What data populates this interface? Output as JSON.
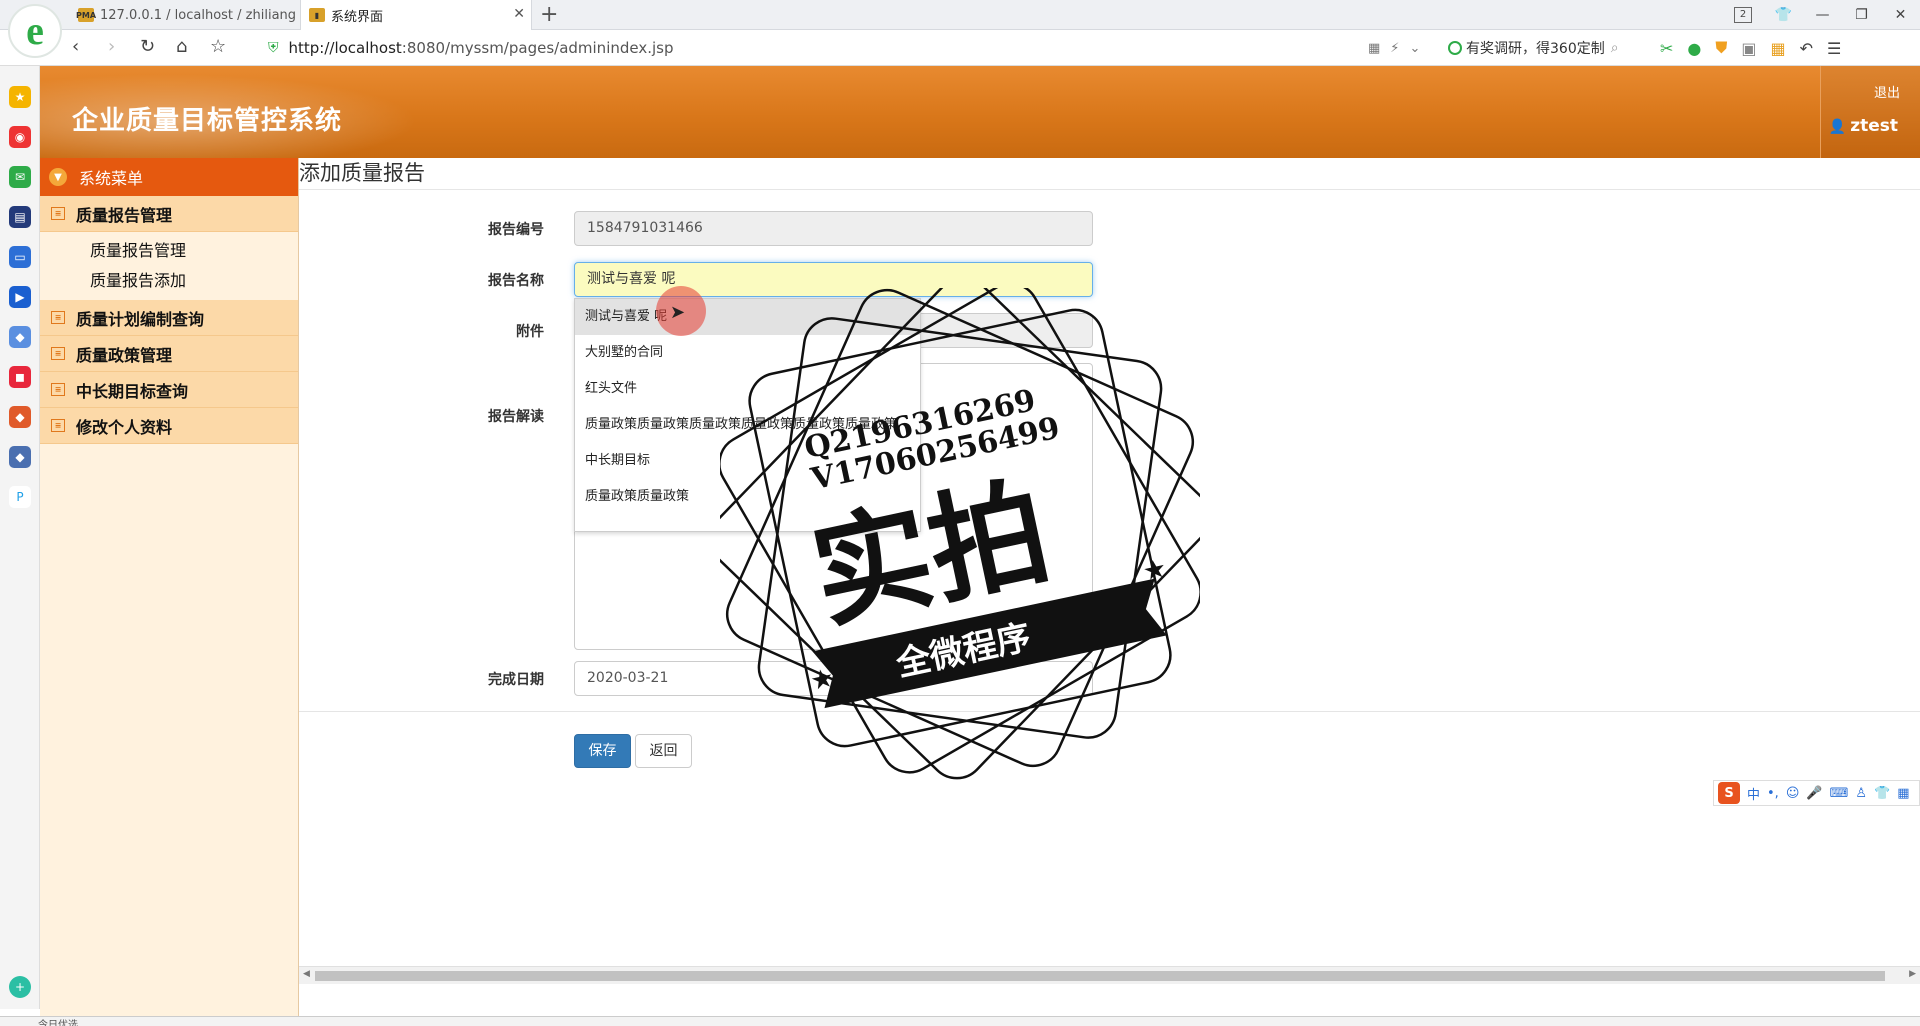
{
  "browser": {
    "tabs": [
      {
        "label": "127.0.0.1 / localhost / zhiliang"
      },
      {
        "label": "系统界面"
      }
    ],
    "tab_count": "2",
    "url_host": "http://localhost",
    "url_rest": ":8080/myssm/pages/adminindex.jsp",
    "promo_text": "有奖调研，得360定制",
    "status_text": "今日优选"
  },
  "app": {
    "title": "企业质量目标管控系统",
    "logout_label": "退出",
    "username": "ztest",
    "colors": {
      "header": "#d9771a",
      "menu_head": "#e5590f",
      "menu_group": "#fcd9a8",
      "primary_button": "#337ab7"
    }
  },
  "menu": {
    "header": "系统菜单",
    "groups": [
      {
        "label": "质量报告管理",
        "items": [
          "质量报告管理",
          "质量报告添加"
        ]
      },
      {
        "label": "质量计划编制查询"
      },
      {
        "label": "质量政策管理"
      },
      {
        "label": "中长期目标查询"
      },
      {
        "label": "修改个人资料"
      }
    ]
  },
  "form": {
    "page_title": "添加质量报告",
    "labels": {
      "no": "报告编号",
      "name": "报告名称",
      "attachment": "附件",
      "desc": "报告解读",
      "date": "完成日期"
    },
    "values": {
      "no": "1584791031466",
      "name": "测试与喜爱 呢",
      "date": "2020-03-21"
    },
    "save_label": "保存",
    "back_label": "返回"
  },
  "autocomplete": [
    "测试与喜爱 呢",
    "大别墅的合同",
    "红头文件",
    "质量政策质量政策质量政策质量政策质量政策质量政策",
    "中长期目标",
    "质量政策质量政策"
  ],
  "watermark": {
    "line1": "Q2196316269",
    "line2": "V17060256499",
    "big": "实拍",
    "ribbon": "全微程序"
  },
  "ime": {
    "label": "中"
  }
}
